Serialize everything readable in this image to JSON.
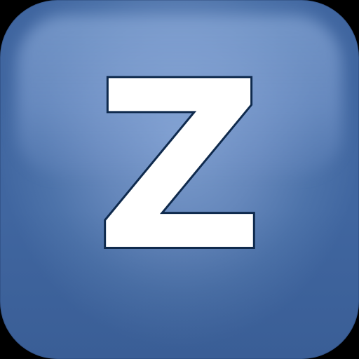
{
  "app_icon": {
    "letter": "Z",
    "colors": {
      "tile": "#5a7fb8",
      "highlight": "#8aa9d6",
      "letter_fill": "#ffffff",
      "letter_outline": "#0f2a4d"
    }
  }
}
